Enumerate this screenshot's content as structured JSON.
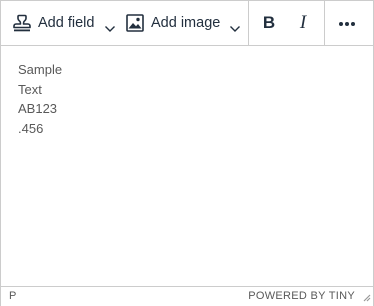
{
  "toolbar": {
    "add_field_label": "Add field",
    "add_field_icon": "stamp-icon",
    "add_image_label": "Add image",
    "add_image_icon": "image-icon",
    "bold_label": "B",
    "italic_label": "I",
    "more_icon": "more-horizontal-icon",
    "text_color": "#222f3e"
  },
  "content": {
    "lines": [
      "Sample",
      "Text",
      "AB123",
      ".456"
    ]
  },
  "statusbar": {
    "path": "P",
    "branding": "POWERED BY TINY",
    "resize_icon": "resize-handle-icon"
  },
  "colors": {
    "border": "#cccccc",
    "content_text": "#595959"
  }
}
